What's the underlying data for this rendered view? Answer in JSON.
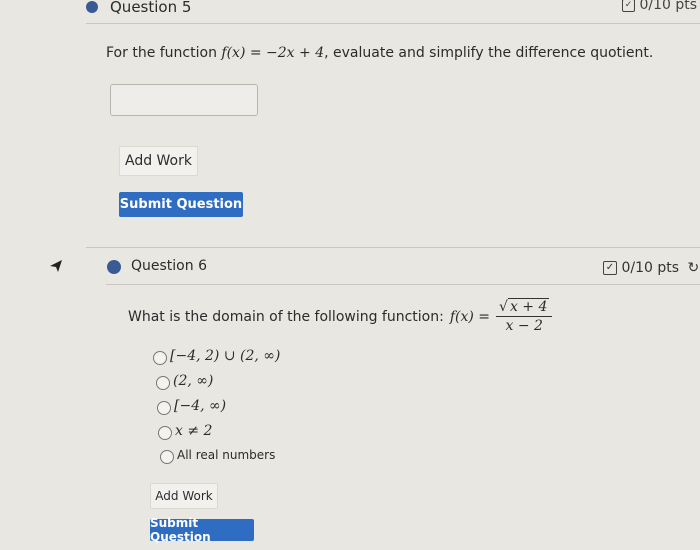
{
  "question5": {
    "title": "Question 5",
    "points": "0/10 pts",
    "prompt_prefix": "For the function",
    "function_expr": "f(x) = −2x + 4",
    "prompt_suffix": ", evaluate and simplify the difference quotient.",
    "answer_value": "",
    "add_work_label": "Add Work",
    "submit_label": "Submit Question"
  },
  "question6": {
    "title": "Question 6",
    "points": "0/10 pts",
    "prompt": "What is the domain of the following function:",
    "function_lhs": "f(x) =",
    "numerator_sqrt": "x + 4",
    "denominator": "x − 2",
    "options": [
      {
        "label": "[−4, 2) ∪ (2, ∞)",
        "selected": false
      },
      {
        "label": "(2, ∞)",
        "selected": false
      },
      {
        "label": "[−4, ∞)",
        "selected": false
      },
      {
        "label": "x ≠ 2",
        "selected": false
      },
      {
        "label": "All real numbers",
        "selected": false
      }
    ],
    "add_work_label": "Add Work",
    "submit_label": "Submit Question"
  },
  "colors": {
    "accent": "#2f6dc3",
    "bullet": "#3a5a95",
    "background": "#e9e7e2"
  },
  "icons": [
    "edit-check-icon",
    "retry-icon",
    "mouse-cursor-icon"
  ]
}
